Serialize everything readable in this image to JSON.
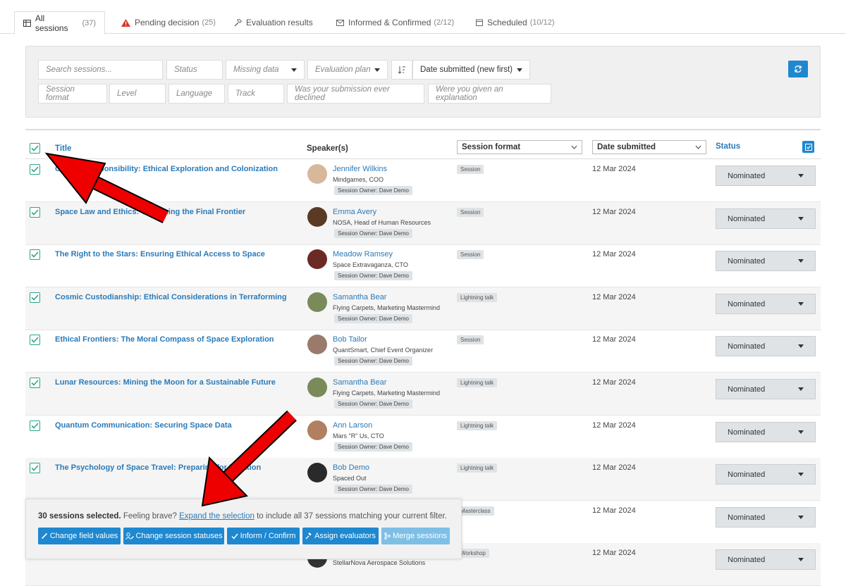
{
  "tabs": [
    {
      "label": "All sessions",
      "count": "(37)",
      "icon": "grid-icon"
    },
    {
      "label": "Pending decision",
      "count": "(25)",
      "icon": "warning-icon"
    },
    {
      "label": "Evaluation results",
      "count": "",
      "icon": "gavel-icon"
    },
    {
      "label": "Informed & Confirmed",
      "count": "(2/12)",
      "icon": "envelope-icon"
    },
    {
      "label": "Scheduled",
      "count": "(10/12)",
      "icon": "calendar-icon"
    }
  ],
  "filters": {
    "search": "Search sessions...",
    "status": "Status",
    "missing": "Missing data",
    "evalplan": "Evaluation plan",
    "sort": "Date submitted (new first)",
    "format": "Session format",
    "level": "Level",
    "language": "Language",
    "track": "Track",
    "declined": "Was your submission ever declined",
    "explanation": "Were you given an explanation"
  },
  "header": {
    "title": "Title",
    "speakers": "Speaker(s)",
    "format": "Session format",
    "date": "Date submitted",
    "status": "Status"
  },
  "rows": [
    {
      "title": "Cosmic Responsibility: Ethical Exploration and Colonization",
      "speaker": "Jennifer Wilkins",
      "org": "Mindgames, COO",
      "owner": "Session Owner: Dave Demo",
      "format": "Session",
      "date": "12 Mar 2024",
      "status": "Nominated"
    },
    {
      "title": "Space Law and Ethics: Governing the Final Frontier",
      "speaker": "Emma Avery",
      "org": "NOSA, Head of Human Resources",
      "owner": "Session Owner: Dave Demo",
      "format": "Session",
      "date": "12 Mar 2024",
      "status": "Nominated"
    },
    {
      "title": "The Right to the Stars: Ensuring Ethical Access to Space",
      "speaker": "Meadow Ramsey",
      "org": "Space Extravaganza, CTO",
      "owner": "Session Owner: Dave Demo",
      "format": "Session",
      "date": "12 Mar 2024",
      "status": "Nominated"
    },
    {
      "title": "Cosmic Custodianship: Ethical Considerations in Terraforming",
      "speaker": "Samantha Bear",
      "org": "Flying Carpets, Marketing Mastermind",
      "owner": "Session Owner: Dave Demo",
      "format": "Lightning talk",
      "date": "12 Mar 2024",
      "status": "Nominated"
    },
    {
      "title": "Ethical Frontiers: The Moral Compass of Space Exploration",
      "speaker": "Bob Tailor",
      "org": "QuantSmart, Chief Event Organizer",
      "owner": "Session Owner: Dave Demo",
      "format": "Session",
      "date": "12 Mar 2024",
      "status": "Nominated"
    },
    {
      "title": "Lunar Resources: Mining the Moon for a Sustainable Future",
      "speaker": "Samantha Bear",
      "org": "Flying Carpets, Marketing Mastermind",
      "owner": "Session Owner: Dave Demo",
      "format": "Lightning talk",
      "date": "12 Mar 2024",
      "status": "Nominated"
    },
    {
      "title": "Quantum Communication: Securing Space Data",
      "speaker": "Ann Larson",
      "org": "Mars \"R\" Us, CTO",
      "owner": "Session Owner: Dave Demo",
      "format": "Lightning talk",
      "date": "12 Mar 2024",
      "status": "Nominated"
    },
    {
      "title": "The Psychology of Space Travel: Preparing for Isolation",
      "speaker": "Bob Demo",
      "org": "Spaced Out",
      "owner": "Session Owner: Dave Demo",
      "format": "Lightning talk",
      "date": "12 Mar 2024",
      "status": "Nominated"
    },
    {
      "title": "",
      "speaker": "",
      "org": "",
      "owner": "",
      "format": "Masterclass",
      "date": "12 Mar 2024",
      "status": "Nominated"
    },
    {
      "title": "",
      "speaker": "",
      "org": "StellarNova Aerospace Solutions",
      "owner": "",
      "format": "Workshop",
      "date": "12 Mar 2024",
      "status": "Nominated"
    }
  ],
  "bulk": {
    "selected": "30 sessions selected.",
    "brave": "Feeling brave?",
    "expand": "Expand the selection",
    "rest": "to include all 37 sessions matching your current filter.",
    "buttons": [
      "Change field values",
      "Change session statuses",
      "Inform / Confirm",
      "Assign evaluators",
      "Merge sessions"
    ]
  },
  "colors": {
    "accent": "#1e88d0",
    "check": "#2aa48a",
    "link": "#2a7ab8",
    "arrow": "#ee0000"
  }
}
